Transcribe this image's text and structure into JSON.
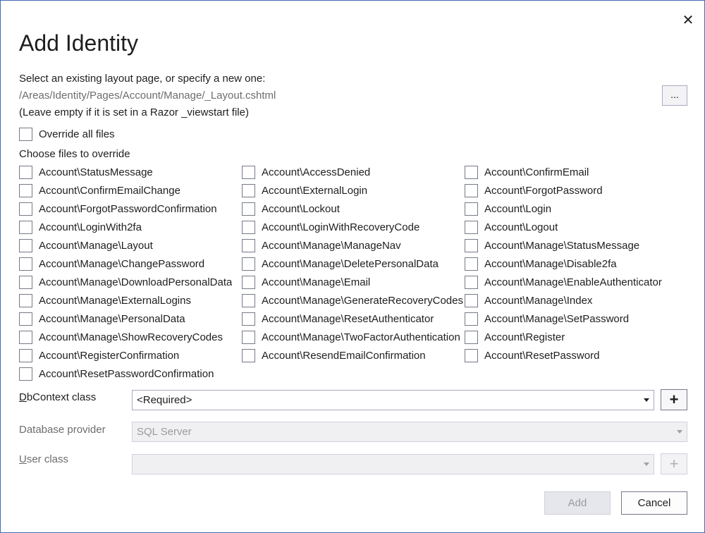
{
  "dialog": {
    "title": "Add Identity",
    "close_glyph": "✕",
    "close_icon": "close-icon"
  },
  "layout": {
    "prompt": "Select an existing layout page, or specify a new one:",
    "path": "/Areas/Identity/Pages/Account/Manage/_Layout.cshtml",
    "hint": "(Leave empty if it is set in a Razor _viewstart file)",
    "browse_label": "..."
  },
  "override_all": {
    "label": "Override all files",
    "checked": false
  },
  "choose_files_label": "Choose files to override",
  "files": [
    "Account\\StatusMessage",
    "Account\\AccessDenied",
    "Account\\ConfirmEmail",
    "Account\\ConfirmEmailChange",
    "Account\\ExternalLogin",
    "Account\\ForgotPassword",
    "Account\\ForgotPasswordConfirmation",
    "Account\\Lockout",
    "Account\\Login",
    "Account\\LoginWith2fa",
    "Account\\LoginWithRecoveryCode",
    "Account\\Logout",
    "Account\\Manage\\Layout",
    "Account\\Manage\\ManageNav",
    "Account\\Manage\\StatusMessage",
    "Account\\Manage\\ChangePassword",
    "Account\\Manage\\DeletePersonalData",
    "Account\\Manage\\Disable2fa",
    "Account\\Manage\\DownloadPersonalData",
    "Account\\Manage\\Email",
    "Account\\Manage\\EnableAuthenticator",
    "Account\\Manage\\ExternalLogins",
    "Account\\Manage\\GenerateRecoveryCodes",
    "Account\\Manage\\Index",
    "Account\\Manage\\PersonalData",
    "Account\\Manage\\ResetAuthenticator",
    "Account\\Manage\\SetPassword",
    "Account\\Manage\\ShowRecoveryCodes",
    "Account\\Manage\\TwoFactorAuthentication",
    "Account\\Register",
    "Account\\RegisterConfirmation",
    "Account\\ResendEmailConfirmation",
    "Account\\ResetPassword",
    "Account\\ResetPasswordConfirmation"
  ],
  "dbcontext": {
    "label": "DbContext class",
    "value": "<Required>",
    "add_glyph": "+"
  },
  "database_provider": {
    "label": "Database provider",
    "value": "SQL Server"
  },
  "user_class": {
    "label": "User class",
    "value": "",
    "add_glyph": "+"
  },
  "buttons": {
    "add": "Add",
    "cancel": "Cancel"
  },
  "colors": {
    "border": "#3f6fb5",
    "disabled_text": "#9b9b9b"
  }
}
